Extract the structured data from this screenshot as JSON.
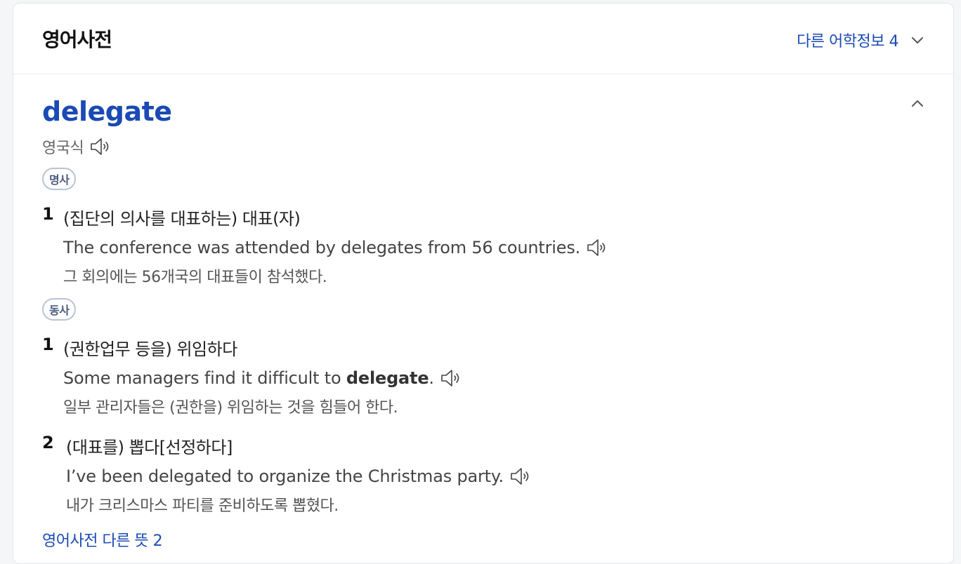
{
  "header": {
    "title": "영어사전",
    "other_info": "다른 어학정보 4"
  },
  "entry": {
    "word": "delegate",
    "pron_label": "영국식",
    "noun": {
      "pos": "명사",
      "senses": [
        {
          "num": "1",
          "meaning": "(집단의 의사를 대표하는) 대표(자)",
          "example_en": "The conference was attended by delegates from 56 countries.",
          "example_ko": "그 회의에는 56개국의 대표들이 참석했다."
        }
      ]
    },
    "verb": {
      "pos": "동사",
      "senses": [
        {
          "num": "1",
          "meaning": "(권한업무 등을) 위임하다",
          "example_en_pre": "Some managers find it difficult to ",
          "example_en_bold": "delegate",
          "example_en_post": ".",
          "example_ko": "일부 관리자들은 (권한을) 위임하는 것을 힘들어 한다."
        },
        {
          "num": "2",
          "meaning": "(대표를) 뽑다[선정하다]",
          "example_en": "I’ve been delegated to organize the Christmas party.",
          "example_ko": "내가 크리스마스 파티를 준비하도록 뽑혔다."
        }
      ]
    },
    "more_link": "영어사전 다른 뜻 2"
  }
}
